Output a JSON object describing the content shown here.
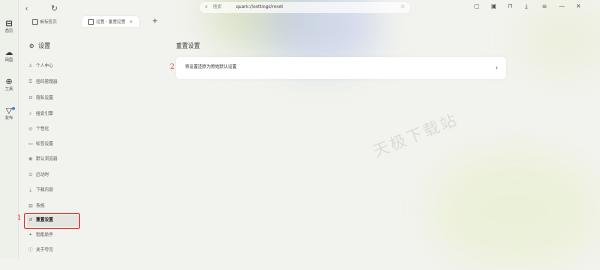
{
  "rail": {
    "items": [
      {
        "label": "首页",
        "icon": "home-icon"
      },
      {
        "label": "网盘",
        "icon": "cloud-icon"
      },
      {
        "label": "工具",
        "icon": "tools-icon"
      },
      {
        "label": "发布",
        "icon": "funnel-icon"
      }
    ]
  },
  "tabs": [
    {
      "label": "新标签页"
    },
    {
      "label": "设置 - 重置设置"
    }
  ],
  "address": {
    "placeholder": "搜索",
    "url": "quark://settings/reset"
  },
  "settings": {
    "title": "设置",
    "menu": [
      {
        "label": "个人中心",
        "icon": "user-icon"
      },
      {
        "label": "密码管理器",
        "icon": "key-icon"
      },
      {
        "label": "隐私设置",
        "icon": "lock-icon"
      },
      {
        "label": "搜索引擎",
        "icon": "search-icon"
      },
      {
        "label": "个性化",
        "icon": "palette-icon"
      },
      {
        "label": "标签设置",
        "icon": "tag-icon"
      },
      {
        "label": "默认浏览器",
        "icon": "browser-icon"
      },
      {
        "label": "启动时",
        "icon": "power-icon"
      },
      {
        "label": "下载内容",
        "icon": "download-icon"
      },
      {
        "label": "系统",
        "icon": "system-icon"
      },
      {
        "label": "重置设置",
        "icon": "reset-icon"
      },
      {
        "label": "智能助手",
        "icon": "assistant-icon"
      },
      {
        "label": "关于夸克",
        "icon": "info-icon"
      }
    ]
  },
  "page": {
    "title": "重置设置",
    "option_label": "将设置还原为原始默认设置"
  },
  "annotations": {
    "step1": "1",
    "step2": "2",
    "color": "#d93a3a"
  },
  "watermark": "天极下载站"
}
